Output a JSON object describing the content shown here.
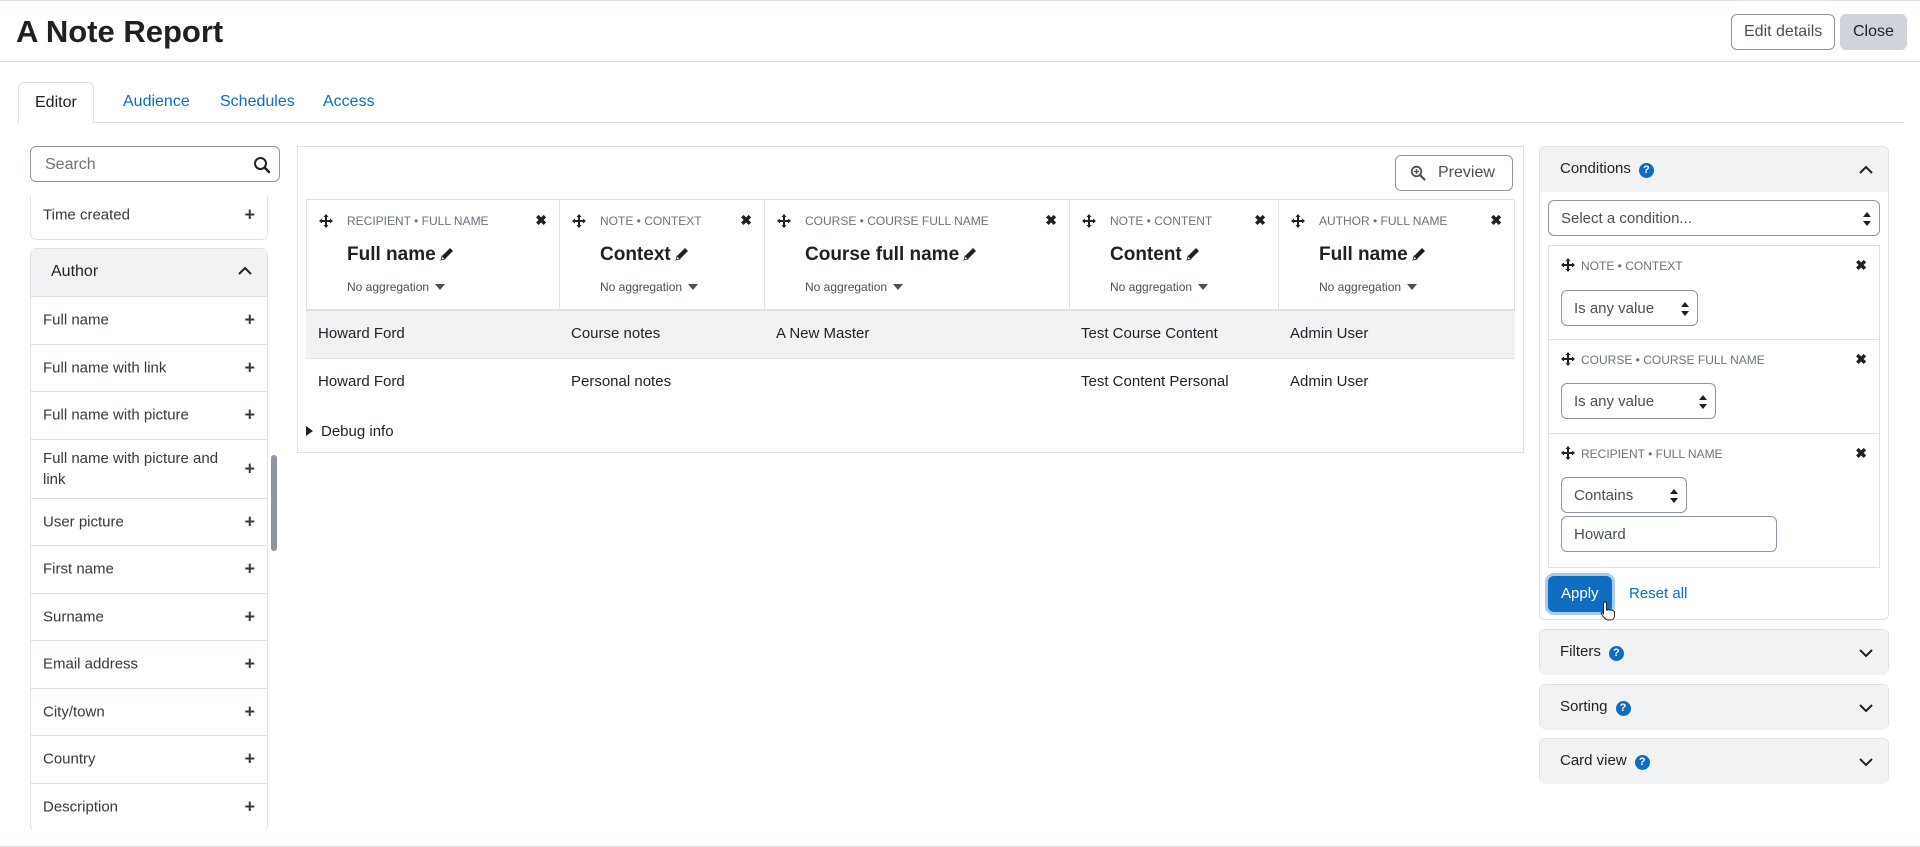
{
  "header": {
    "title": "A Note Report",
    "edit_details": "Edit details",
    "close": "Close"
  },
  "tabs": [
    {
      "label": "Editor",
      "active": true
    },
    {
      "label": "Audience",
      "active": false
    },
    {
      "label": "Schedules",
      "active": false
    },
    {
      "label": "Access",
      "active": false
    }
  ],
  "sidebar": {
    "search_placeholder": "Search",
    "top_items": [
      {
        "label": "Time created"
      }
    ],
    "group": {
      "title": "Author",
      "items": [
        {
          "label": "Full name"
        },
        {
          "label": "Full name with link"
        },
        {
          "label": "Full name with picture"
        },
        {
          "label": "Full name with picture and link"
        },
        {
          "label": "User picture"
        },
        {
          "label": "First name"
        },
        {
          "label": "Surname"
        },
        {
          "label": "Email address"
        },
        {
          "label": "City/town"
        },
        {
          "label": "Country"
        },
        {
          "label": "Description"
        }
      ]
    }
  },
  "main": {
    "preview": "Preview",
    "columns": [
      {
        "source": "RECIPIENT • FULL NAME",
        "name": "Full name",
        "aggregation": "No aggregation"
      },
      {
        "source": "NOTE • CONTEXT",
        "name": "Context",
        "aggregation": "No aggregation"
      },
      {
        "source": "COURSE • COURSE FULL NAME",
        "name": "Course full name",
        "aggregation": "No aggregation"
      },
      {
        "source": "NOTE • CONTENT",
        "name": "Content",
        "aggregation": "No aggregation"
      },
      {
        "source": "AUTHOR • FULL NAME",
        "name": "Full name",
        "aggregation": "No aggregation"
      }
    ],
    "rows": [
      [
        "Howard Ford",
        "Course notes",
        "A New Master",
        "Test Course Content",
        "Admin User"
      ],
      [
        "Howard Ford",
        "Personal notes",
        "",
        "Test Content Personal",
        "Admin User"
      ]
    ],
    "debug": "Debug info"
  },
  "conditions": {
    "title": "Conditions",
    "select_placeholder": "Select a condition...",
    "items": [
      {
        "source": "NOTE • CONTEXT",
        "operator": "Is any value"
      },
      {
        "source": "COURSE • COURSE FULL NAME",
        "operator": "Is any value"
      },
      {
        "source": "RECIPIENT • FULL NAME",
        "operator": "Contains",
        "value": "Howard"
      }
    ],
    "apply": "Apply",
    "reset": "Reset all"
  },
  "panels": [
    {
      "title": "Filters"
    },
    {
      "title": "Sorting"
    },
    {
      "title": "Card view"
    }
  ],
  "colors": {
    "accent": "#0f6cbf",
    "border": "#dee2e6",
    "muted": "#6a737b"
  }
}
